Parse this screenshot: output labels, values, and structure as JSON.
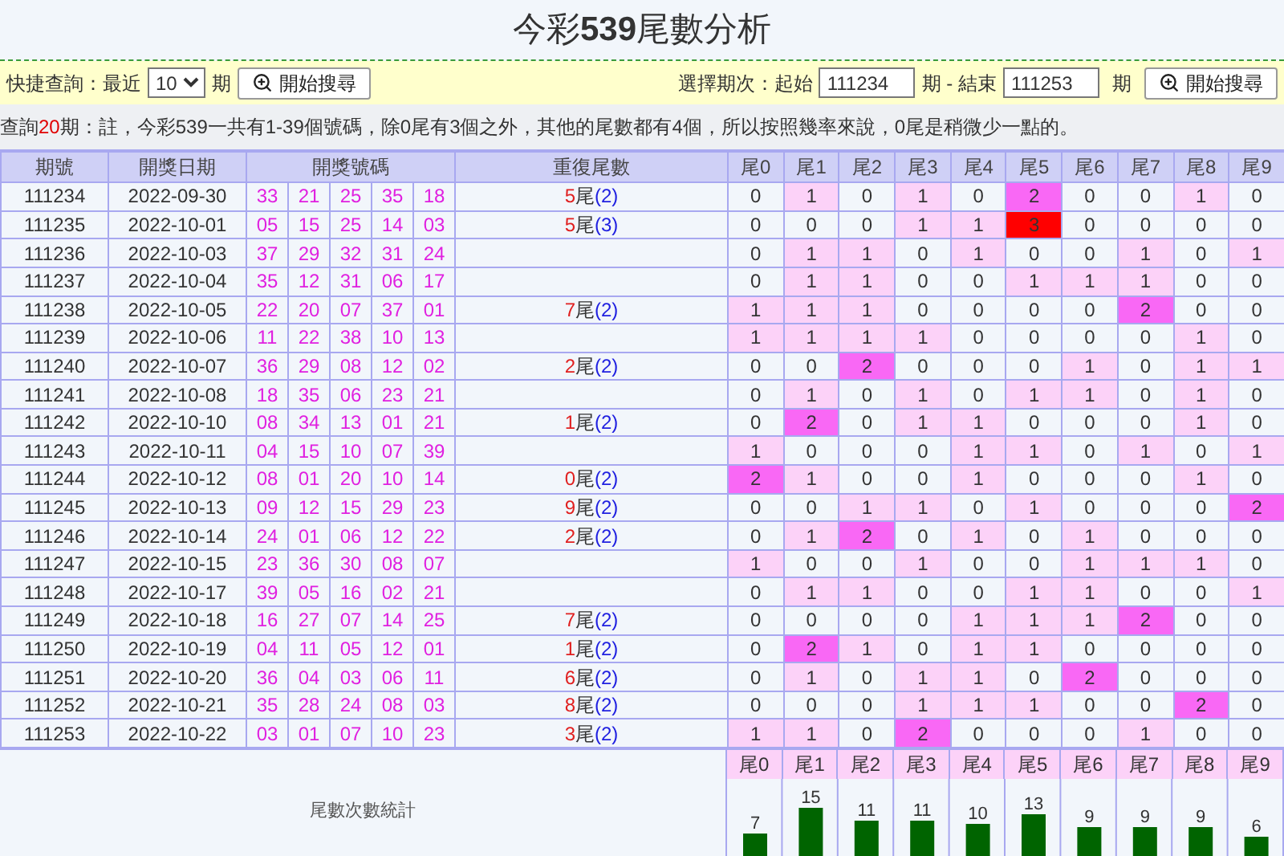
{
  "title": "今彩**539**尾數分析",
  "toolbar": {
    "quick_label": "快捷查詢：最近",
    "quick_value": "10",
    "quick_unit": "期",
    "search_button": "開始搜尋",
    "range_label": "選擇期次：起始",
    "start_value": "111234",
    "range_mid": "期 - 結束",
    "end_value": "111253",
    "range_unit": "期",
    "search_button_2": "開始搜尋"
  },
  "note": {
    "prefix": "查詢",
    "count": "20",
    "text": "期：註，今彩539一共有1-39個號碼，除0尾有3個之外，其他的尾數都有4個，所以按照幾率來說，0尾是稍微少一點的。"
  },
  "table": {
    "columns": [
      "期號",
      "開獎日期",
      "開獎號碼",
      "重復尾數",
      "尾0",
      "尾1",
      "尾2",
      "尾3",
      "尾4",
      "尾5",
      "尾6",
      "尾7",
      "尾8",
      "尾9"
    ],
    "rows": [
      {
        "period": "111234",
        "date": "2022-09-30",
        "numbers": [
          "33",
          "21",
          "25",
          "35",
          "18"
        ],
        "repeat": {
          "tail": "5",
          "mark": "尾",
          "count": "(2)"
        },
        "counts": [
          "0",
          "1",
          "0",
          "1",
          "0",
          "2",
          "0",
          "0",
          "1",
          "0"
        ]
      },
      {
        "period": "111235",
        "date": "2022-10-01",
        "numbers": [
          "05",
          "15",
          "25",
          "14",
          "03"
        ],
        "repeat": {
          "tail": "5",
          "mark": "尾",
          "count": "(3)"
        },
        "counts": [
          "0",
          "0",
          "0",
          "1",
          "1",
          "3",
          "0",
          "0",
          "0",
          "0"
        ]
      },
      {
        "period": "111236",
        "date": "2022-10-03",
        "numbers": [
          "37",
          "29",
          "32",
          "31",
          "24"
        ],
        "counts": [
          "0",
          "1",
          "1",
          "0",
          "1",
          "0",
          "0",
          "1",
          "0",
          "1"
        ]
      },
      {
        "period": "111237",
        "date": "2022-10-04",
        "numbers": [
          "35",
          "12",
          "31",
          "06",
          "17"
        ],
        "counts": [
          "0",
          "1",
          "1",
          "0",
          "0",
          "1",
          "1",
          "1",
          "0",
          "0"
        ]
      },
      {
        "period": "111238",
        "date": "2022-10-05",
        "numbers": [
          "22",
          "20",
          "07",
          "37",
          "01"
        ],
        "repeat": {
          "tail": "7",
          "mark": "尾",
          "count": "(2)"
        },
        "counts": [
          "1",
          "1",
          "1",
          "0",
          "0",
          "0",
          "0",
          "2",
          "0",
          "0"
        ]
      },
      {
        "period": "111239",
        "date": "2022-10-06",
        "numbers": [
          "11",
          "22",
          "38",
          "10",
          "13"
        ],
        "counts": [
          "1",
          "1",
          "1",
          "1",
          "0",
          "0",
          "0",
          "0",
          "1",
          "0"
        ]
      },
      {
        "period": "111240",
        "date": "2022-10-07",
        "numbers": [
          "36",
          "29",
          "08",
          "12",
          "02"
        ],
        "repeat": {
          "tail": "2",
          "mark": "尾",
          "count": "(2)"
        },
        "counts": [
          "0",
          "0",
          "2",
          "0",
          "0",
          "0",
          "1",
          "0",
          "1",
          "1"
        ]
      },
      {
        "period": "111241",
        "date": "2022-10-08",
        "numbers": [
          "18",
          "35",
          "06",
          "23",
          "21"
        ],
        "counts": [
          "0",
          "1",
          "0",
          "1",
          "0",
          "1",
          "1",
          "0",
          "1",
          "0"
        ]
      },
      {
        "period": "111242",
        "date": "2022-10-10",
        "numbers": [
          "08",
          "34",
          "13",
          "01",
          "21"
        ],
        "repeat": {
          "tail": "1",
          "mark": "尾",
          "count": "(2)"
        },
        "counts": [
          "0",
          "2",
          "0",
          "1",
          "1",
          "0",
          "0",
          "0",
          "1",
          "0"
        ]
      },
      {
        "period": "111243",
        "date": "2022-10-11",
        "numbers": [
          "04",
          "15",
          "10",
          "07",
          "39"
        ],
        "counts": [
          "1",
          "0",
          "0",
          "0",
          "1",
          "1",
          "0",
          "1",
          "0",
          "1"
        ]
      },
      {
        "period": "111244",
        "date": "2022-10-12",
        "numbers": [
          "08",
          "01",
          "20",
          "10",
          "14"
        ],
        "repeat": {
          "tail": "0",
          "mark": "尾",
          "count": "(2)"
        },
        "counts": [
          "2",
          "1",
          "0",
          "0",
          "1",
          "0",
          "0",
          "0",
          "1",
          "0"
        ]
      },
      {
        "period": "111245",
        "date": "2022-10-13",
        "numbers": [
          "09",
          "12",
          "15",
          "29",
          "23"
        ],
        "repeat": {
          "tail": "9",
          "mark": "尾",
          "count": "(2)"
        },
        "counts": [
          "0",
          "0",
          "1",
          "1",
          "0",
          "1",
          "0",
          "0",
          "0",
          "2"
        ]
      },
      {
        "period": "111246",
        "date": "2022-10-14",
        "numbers": [
          "24",
          "01",
          "06",
          "12",
          "22"
        ],
        "repeat": {
          "tail": "2",
          "mark": "尾",
          "count": "(2)"
        },
        "counts": [
          "0",
          "1",
          "2",
          "0",
          "1",
          "0",
          "1",
          "0",
          "0",
          "0"
        ]
      },
      {
        "period": "111247",
        "date": "2022-10-15",
        "numbers": [
          "23",
          "36",
          "30",
          "08",
          "07"
        ],
        "counts": [
          "1",
          "0",
          "0",
          "1",
          "0",
          "0",
          "1",
          "1",
          "1",
          "0"
        ]
      },
      {
        "period": "111248",
        "date": "2022-10-17",
        "numbers": [
          "39",
          "05",
          "16",
          "02",
          "21"
        ],
        "counts": [
          "0",
          "1",
          "1",
          "0",
          "0",
          "1",
          "1",
          "0",
          "0",
          "1"
        ]
      },
      {
        "period": "111249",
        "date": "2022-10-18",
        "numbers": [
          "16",
          "27",
          "07",
          "14",
          "25"
        ],
        "repeat": {
          "tail": "7",
          "mark": "尾",
          "count": "(2)"
        },
        "counts": [
          "0",
          "0",
          "0",
          "0",
          "1",
          "1",
          "1",
          "2",
          "0",
          "0"
        ]
      },
      {
        "period": "111250",
        "date": "2022-10-19",
        "numbers": [
          "04",
          "11",
          "05",
          "12",
          "01"
        ],
        "repeat": {
          "tail": "1",
          "mark": "尾",
          "count": "(2)"
        },
        "counts": [
          "0",
          "2",
          "1",
          "0",
          "1",
          "1",
          "0",
          "0",
          "0",
          "0"
        ]
      },
      {
        "period": "111251",
        "date": "2022-10-20",
        "numbers": [
          "36",
          "04",
          "03",
          "06",
          "11"
        ],
        "repeat": {
          "tail": "6",
          "mark": "尾",
          "count": "(2)"
        },
        "counts": [
          "0",
          "1",
          "0",
          "1",
          "1",
          "0",
          "2",
          "0",
          "0",
          "0"
        ]
      },
      {
        "period": "111252",
        "date": "2022-10-21",
        "numbers": [
          "35",
          "28",
          "24",
          "08",
          "03"
        ],
        "repeat": {
          "tail": "8",
          "mark": "尾",
          "count": "(2)"
        },
        "counts": [
          "0",
          "0",
          "0",
          "1",
          "1",
          "1",
          "0",
          "0",
          "2",
          "0"
        ]
      },
      {
        "period": "111253",
        "date": "2022-10-22",
        "numbers": [
          "03",
          "01",
          "07",
          "10",
          "23"
        ],
        "repeat": {
          "tail": "3",
          "mark": "尾",
          "count": "(2)"
        },
        "counts": [
          "1",
          "1",
          "0",
          "2",
          "0",
          "0",
          "0",
          "1",
          "0",
          "0"
        ]
      }
    ]
  },
  "stats": {
    "caption": "尾數次數統計",
    "chart_data": {
      "type": "bar",
      "categories": [
        "尾0",
        "尾1",
        "尾2",
        "尾3",
        "尾4",
        "尾5",
        "尾6",
        "尾7",
        "尾8",
        "尾9"
      ],
      "series": [
        {
          "color": "#006400",
          "values": [
            7,
            15,
            11,
            11,
            10,
            13,
            9,
            9,
            9,
            6
          ]
        }
      ],
      "data_labels": true
    }
  }
}
